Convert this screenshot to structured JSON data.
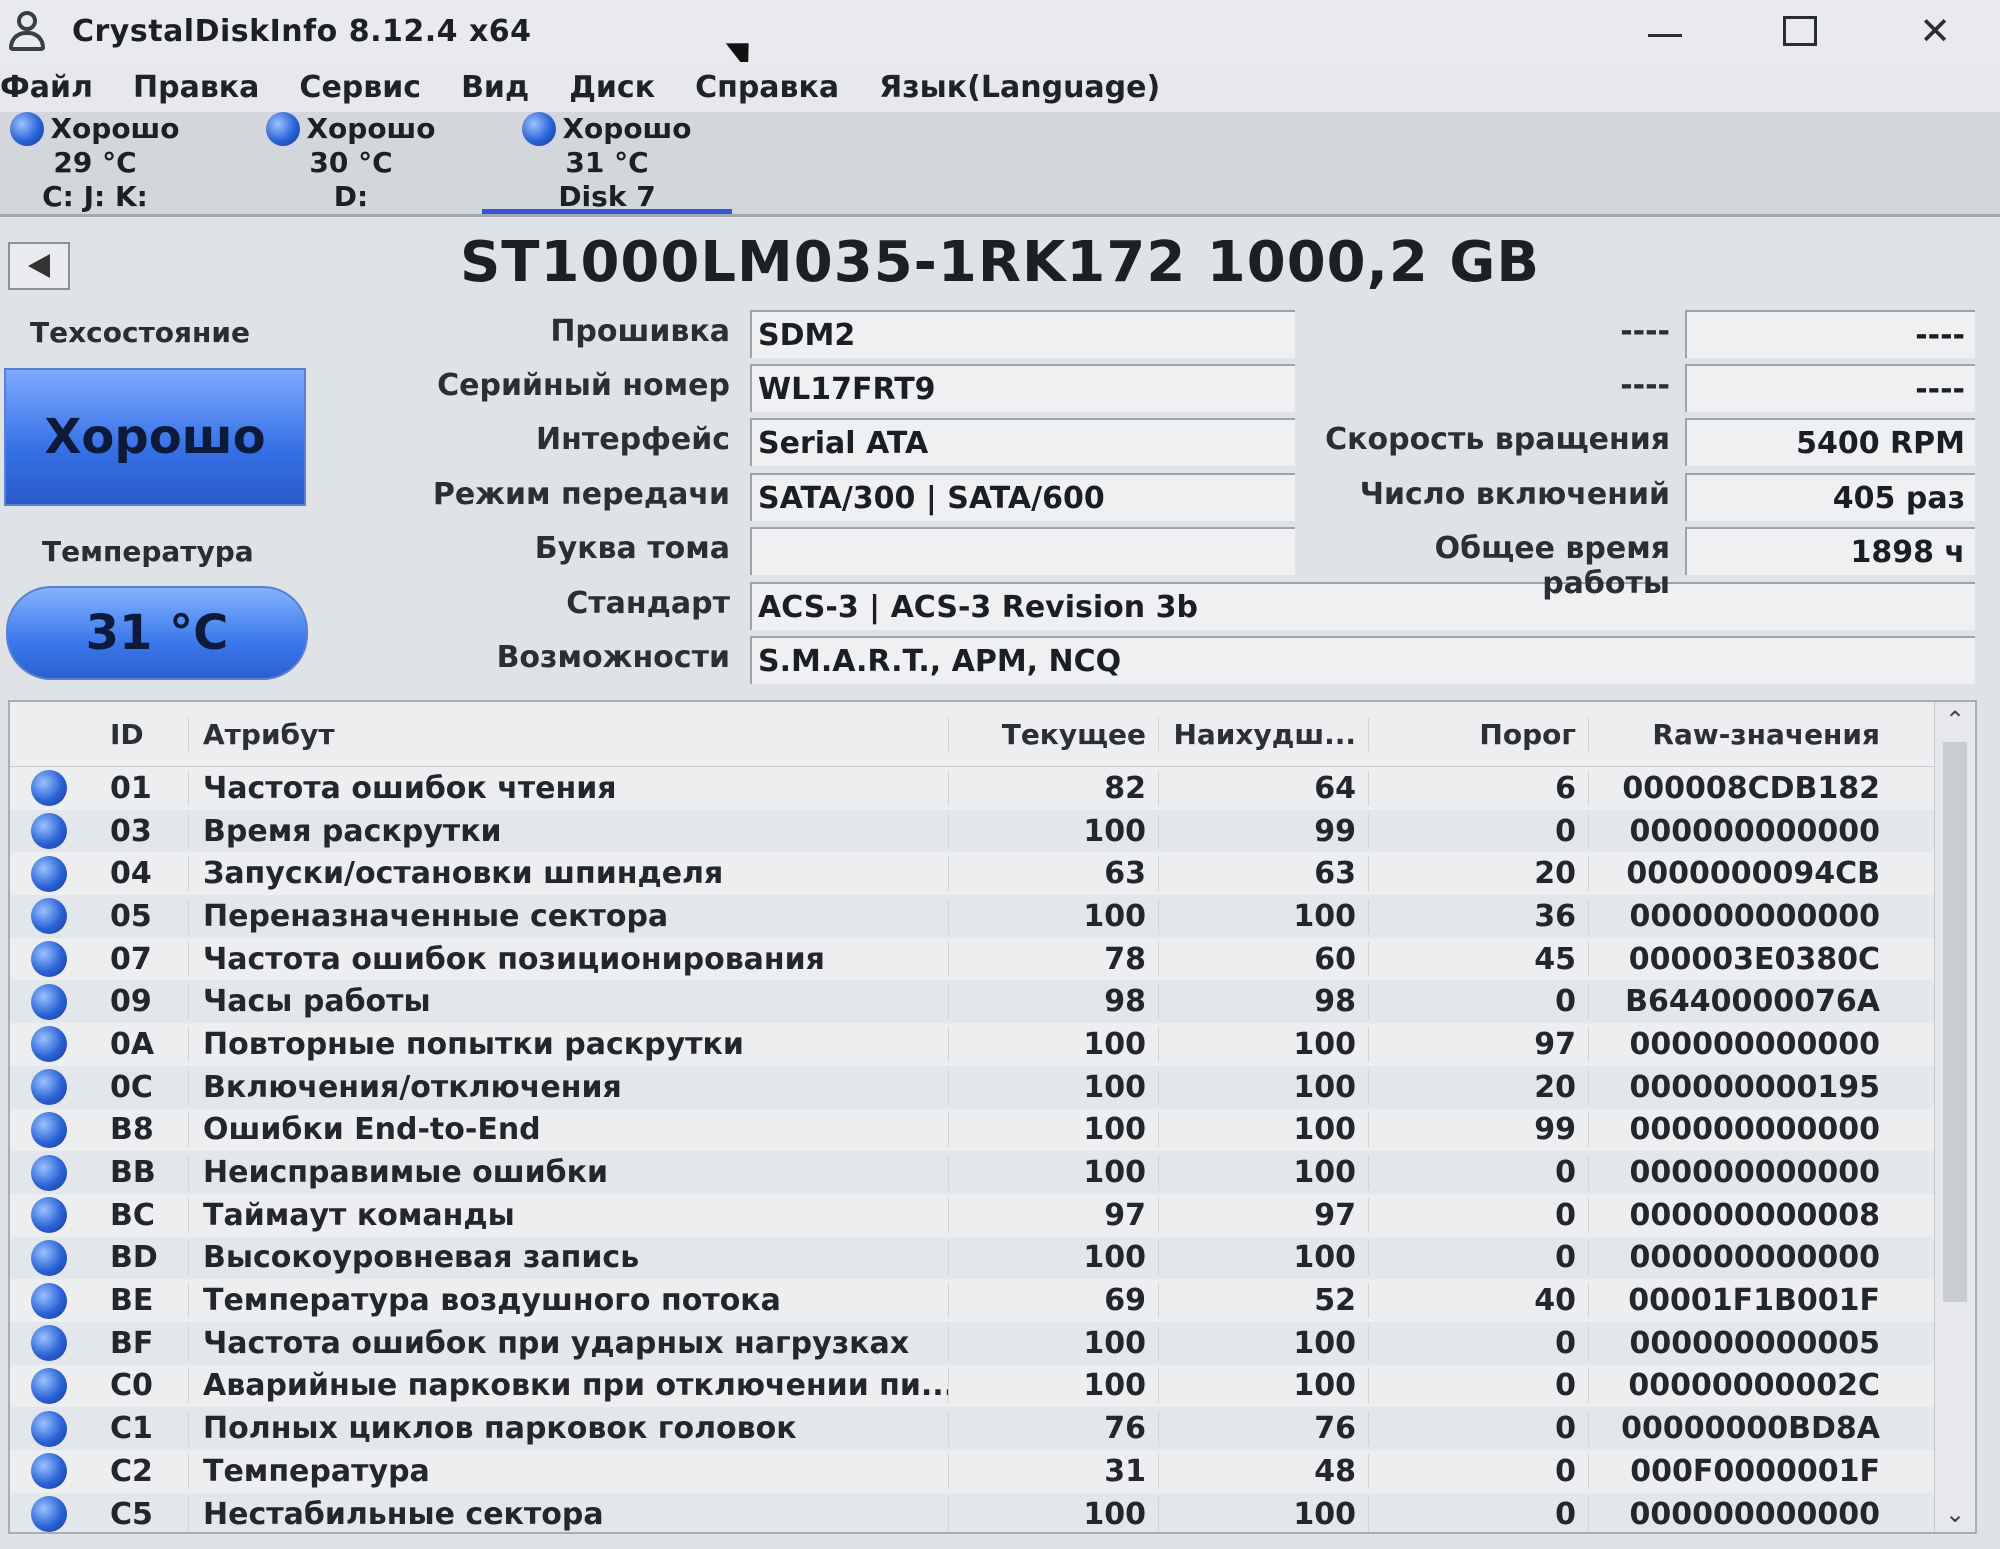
{
  "window": {
    "title": "CrystalDiskInfo 8.12.4 x64",
    "controls": {
      "minimize": "—",
      "maximize": "☐",
      "close": "✕"
    }
  },
  "menu": [
    "Файл",
    "Правка",
    "Сервис",
    "Вид",
    "Диск",
    "Справка",
    "Язык(Language)"
  ],
  "disks": [
    {
      "status": "Хорошо",
      "temp": "29 °C",
      "label": "C: J: K:"
    },
    {
      "status": "Хорошо",
      "temp": "30 °C",
      "label": "D:"
    },
    {
      "status": "Хорошо",
      "temp": "31 °C",
      "label": "Disk 7"
    }
  ],
  "model": "ST1000LM035-1RK172 1000,2 GB",
  "health": {
    "label": "Техсостояние",
    "value": "Хорошо"
  },
  "temperature": {
    "label": "Температура",
    "value": "31 °C"
  },
  "fields": {
    "firmware": {
      "label": "Прошивка",
      "value": "SDM2"
    },
    "serial": {
      "label": "Серийный номер",
      "value": "WL17FRT9"
    },
    "interface": {
      "label": "Интерфейс",
      "value": "Serial ATA"
    },
    "transfer": {
      "label": "Режим передачи",
      "value": "SATA/300 | SATA/600"
    },
    "volume": {
      "label": "Буква тома",
      "value": ""
    },
    "standard": {
      "label": "Стандарт",
      "value": "ACS-3 | ACS-3 Revision 3b"
    },
    "features": {
      "label": "Возможности",
      "value": "S.M.A.R.T., APM, NCQ"
    }
  },
  "right_fields": {
    "blank1": {
      "label": "----",
      "value": "----"
    },
    "blank2": {
      "label": "----",
      "value": "----"
    },
    "rotation": {
      "label": "Скорость вращения",
      "value": "5400 RPM"
    },
    "power_count": {
      "label": "Число включений",
      "value": "405 раз"
    },
    "power_hours": {
      "label": "Общее время работы",
      "value": "1898 ч"
    }
  },
  "table": {
    "headers": {
      "id": "ID",
      "attr": "Атрибут",
      "cur": "Текущее",
      "worst": "Наихудш...",
      "thr": "Порог",
      "raw": "Raw-значения"
    },
    "rows": [
      {
        "id": "01",
        "attr": "Частота ошибок чтения",
        "cur": "82",
        "worst": "64",
        "thr": "6",
        "raw": "000008CDB182"
      },
      {
        "id": "03",
        "attr": "Время раскрутки",
        "cur": "100",
        "worst": "99",
        "thr": "0",
        "raw": "000000000000"
      },
      {
        "id": "04",
        "attr": "Запуски/остановки шпинделя",
        "cur": "63",
        "worst": "63",
        "thr": "20",
        "raw": "0000000094CB"
      },
      {
        "id": "05",
        "attr": "Переназначенные сектора",
        "cur": "100",
        "worst": "100",
        "thr": "36",
        "raw": "000000000000"
      },
      {
        "id": "07",
        "attr": "Частота ошибок позиционирования",
        "cur": "78",
        "worst": "60",
        "thr": "45",
        "raw": "000003E0380C"
      },
      {
        "id": "09",
        "attr": "Часы работы",
        "cur": "98",
        "worst": "98",
        "thr": "0",
        "raw": "B6440000076A"
      },
      {
        "id": "0A",
        "attr": "Повторные попытки раскрутки",
        "cur": "100",
        "worst": "100",
        "thr": "97",
        "raw": "000000000000"
      },
      {
        "id": "0C",
        "attr": "Включения/отключения",
        "cur": "100",
        "worst": "100",
        "thr": "20",
        "raw": "000000000195"
      },
      {
        "id": "B8",
        "attr": "Ошибки End-to-End",
        "cur": "100",
        "worst": "100",
        "thr": "99",
        "raw": "000000000000"
      },
      {
        "id": "BB",
        "attr": "Неисправимые ошибки",
        "cur": "100",
        "worst": "100",
        "thr": "0",
        "raw": "000000000000"
      },
      {
        "id": "BC",
        "attr": "Таймаут команды",
        "cur": "97",
        "worst": "97",
        "thr": "0",
        "raw": "000000000008"
      },
      {
        "id": "BD",
        "attr": "Высокоуровневая запись",
        "cur": "100",
        "worst": "100",
        "thr": "0",
        "raw": "000000000000"
      },
      {
        "id": "BE",
        "attr": "Температура воздушного потока",
        "cur": "69",
        "worst": "52",
        "thr": "40",
        "raw": "00001F1B001F"
      },
      {
        "id": "BF",
        "attr": "Частота ошибок при ударных нагрузках",
        "cur": "100",
        "worst": "100",
        "thr": "0",
        "raw": "000000000005"
      },
      {
        "id": "C0",
        "attr": "Аварийные парковки при отключении пи...",
        "cur": "100",
        "worst": "100",
        "thr": "0",
        "raw": "00000000002C"
      },
      {
        "id": "C1",
        "attr": "Полных циклов парковок головок",
        "cur": "76",
        "worst": "76",
        "thr": "0",
        "raw": "00000000BD8A"
      },
      {
        "id": "C2",
        "attr": "Температура",
        "cur": "31",
        "worst": "48",
        "thr": "0",
        "raw": "000F0000001F"
      },
      {
        "id": "C5",
        "attr": "Нестабильные сектора",
        "cur": "100",
        "worst": "100",
        "thr": "0",
        "raw": "000000000000"
      }
    ]
  }
}
